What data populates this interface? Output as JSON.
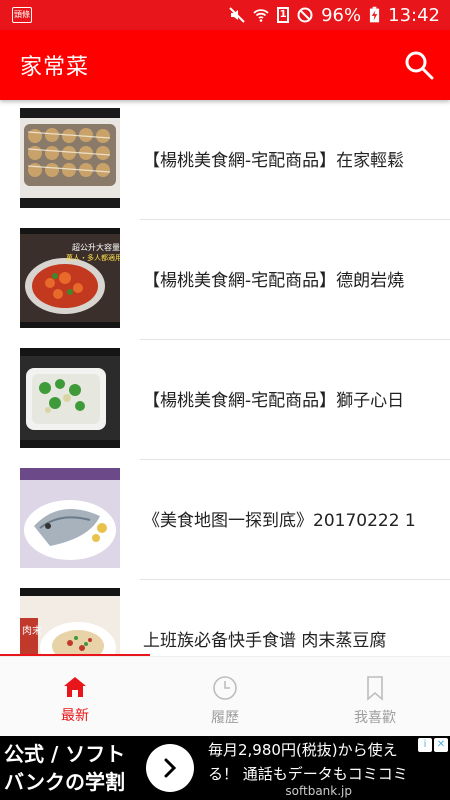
{
  "status_bar": {
    "left_icon": "頭條",
    "sim_badge": "1",
    "battery": "96%",
    "time": "13:42"
  },
  "app_bar": {
    "title": "家常菜",
    "search_icon": "search-icon"
  },
  "list": {
    "items": [
      {
        "title": "【楊桃美食網-宅配商品】在家輕鬆",
        "thumb_icon": "food-thumbnail"
      },
      {
        "title": "【楊桃美食網-宅配商品】德朗岩燒",
        "thumb_icon": "food-thumbnail",
        "thumb_caption_1": "超公升大容量",
        "thumb_caption_2": "萬人・多人都適用"
      },
      {
        "title": "【楊桃美食網-宅配商品】獅子心日",
        "thumb_icon": "food-thumbnail"
      },
      {
        "title": "《美食地图一探到底》20170222 1",
        "thumb_icon": "food-thumbnail"
      },
      {
        "title": "上班族必备快手食谱 肉末蒸豆腐",
        "thumb_icon": "food-thumbnail",
        "thumb_caption_1": "肉末"
      }
    ]
  },
  "bottom_nav": {
    "items": [
      {
        "label": "最新",
        "icon": "home-icon",
        "active": true
      },
      {
        "label": "履歷",
        "icon": "clock-icon",
        "active": false
      },
      {
        "label": "我喜歡",
        "icon": "bookmark-icon",
        "active": false
      }
    ]
  },
  "ad": {
    "left_line_1": "公式 / ソフト",
    "left_line_2": "バンクの学割",
    "right_line_1": "毎月2,980円(税抜)から使え",
    "right_line_2": "る！ 通話もデータもコミコミ",
    "domain": "softbank.jp"
  },
  "colors": {
    "primary": "#ff0000",
    "status_bar": "#e8161a",
    "active": "#e8161a",
    "inactive": "#9e9e9e"
  }
}
